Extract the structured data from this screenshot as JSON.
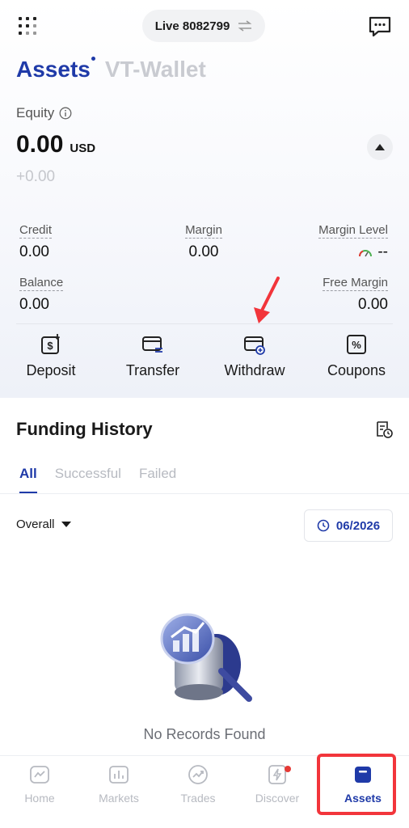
{
  "header": {
    "account_label": "Live 8082799",
    "menu_icon": "grid-icon",
    "swap_icon": "swap-icon",
    "message_icon": "message-icon"
  },
  "page_tabs": {
    "assets": "Assets",
    "vt_wallet": "VT-Wallet"
  },
  "equity": {
    "label": "Equity",
    "value": "0.00",
    "currency": "USD",
    "change": "+0.00"
  },
  "stats": {
    "credit_label": "Credit",
    "credit_value": "0.00",
    "margin_label": "Margin",
    "margin_value": "0.00",
    "margin_level_label": "Margin Level",
    "margin_level_value": "--",
    "balance_label": "Balance",
    "balance_value": "0.00",
    "free_margin_label": "Free Margin",
    "free_margin_value": "0.00"
  },
  "actions": {
    "deposit": "Deposit",
    "transfer": "Transfer",
    "withdraw": "Withdraw",
    "coupons": "Coupons"
  },
  "funding": {
    "title": "Funding History",
    "tabs": [
      "All",
      "Successful",
      "Failed"
    ],
    "filter": "Overall",
    "date": "06/2026",
    "empty_text": "No Records Found"
  },
  "nav": {
    "home": "Home",
    "markets": "Markets",
    "trades": "Trades",
    "discover": "Discover",
    "assets": "Assets"
  },
  "colors": {
    "accent": "#1f3aa8",
    "annotation_red": "#f2353b"
  }
}
